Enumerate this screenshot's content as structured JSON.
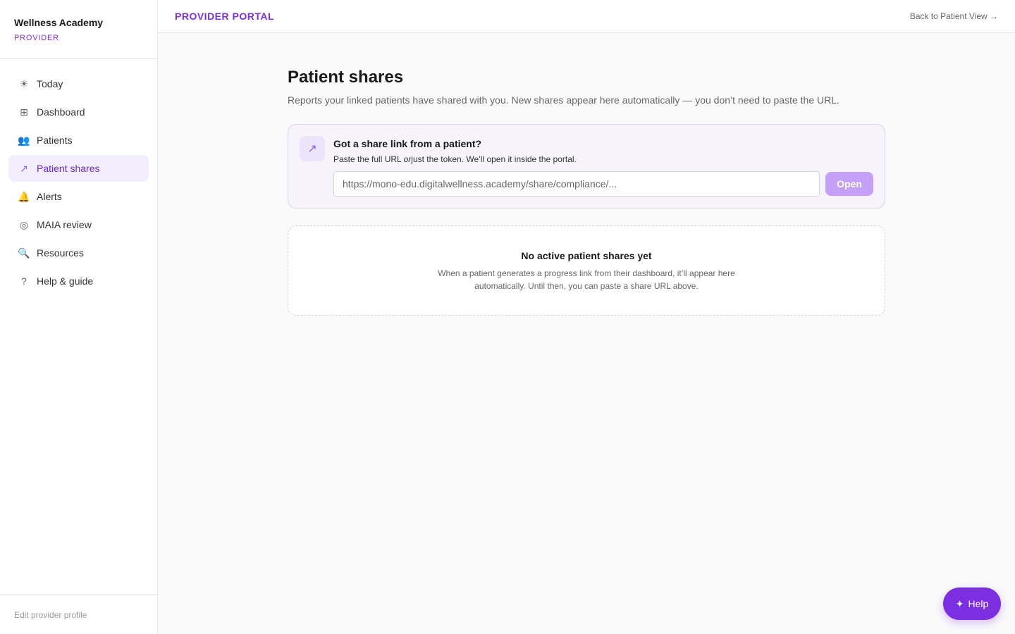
{
  "brand": {
    "name": "Wellness Academy",
    "role": "PROVIDER"
  },
  "sidebar": {
    "items": [
      {
        "label": "Today",
        "icon": "sun-icon",
        "glyph": "☀"
      },
      {
        "label": "Dashboard",
        "icon": "grid-icon",
        "glyph": "⊞"
      },
      {
        "label": "Patients",
        "icon": "people-icon",
        "glyph": "👥"
      },
      {
        "label": "Patient shares",
        "icon": "arrow-up-right-icon",
        "glyph": "↗",
        "active": true
      },
      {
        "label": "Alerts",
        "icon": "bell-icon",
        "glyph": "🔔"
      },
      {
        "label": "MAIA review",
        "icon": "target-icon",
        "glyph": "◎"
      },
      {
        "label": "Resources",
        "icon": "magnifier-icon",
        "glyph": "🔍"
      },
      {
        "label": "Help & guide",
        "icon": "question-icon",
        "glyph": "?"
      }
    ],
    "footer": "Edit provider profile"
  },
  "header": {
    "title": "PROVIDER PORTAL",
    "back_link": "Back to Patient View →"
  },
  "main": {
    "title": "Patient shares",
    "subtitle": "Reports your linked patients have shared with you. New shares appear here automatically — you don’t need to paste the URL.",
    "link_card": {
      "glyph": "↗",
      "title": "Got a share link from a patient?",
      "help_before": "Paste the full URL ",
      "help_em": "or",
      "help_after": "just the token. We’ll open it inside the portal.",
      "placeholder": "https://mono-edu.digitalwellness.academy/share/compliance/...",
      "button": "Open"
    },
    "empty": {
      "title": "No active patient shares yet",
      "text": "When a patient generates a progress link from their dashboard, it’ll appear here automatically. Until then, you can paste a share URL above."
    }
  },
  "help_button": {
    "glyph": "✦",
    "label": "Help"
  },
  "colors": {
    "accent": "#7c2fe0",
    "accent_light": "#c5a0f6",
    "active_bg": "#f3eefc"
  }
}
